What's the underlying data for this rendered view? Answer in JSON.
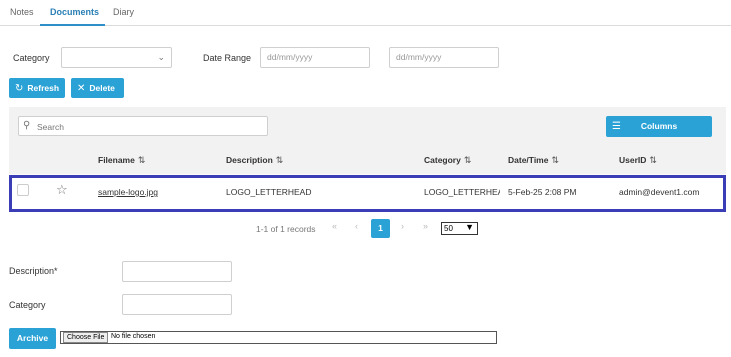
{
  "tabs": [
    {
      "label": "Notes"
    },
    {
      "label": "Documents",
      "active": true
    },
    {
      "label": "Diary"
    }
  ],
  "filters": {
    "category_label": "Category",
    "category_value": "",
    "date_range_label": "Date Range",
    "date_from_placeholder": "dd/mm/yyyy",
    "date_to_placeholder": "dd/mm/yyyy"
  },
  "toolbar": {
    "refresh_label": "Refresh",
    "delete_label": "Delete"
  },
  "table": {
    "search_placeholder": "Search",
    "columns_button_label": "Columns",
    "headers": {
      "filename": "Filename",
      "description": "Description",
      "category": "Category",
      "datetime": "Date/Time",
      "userid": "UserID"
    },
    "rows": [
      {
        "filename": "sample-logo.jpg",
        "description": "LOGO_LETTERHEAD",
        "category": "LOGO_LETTERHEAD",
        "datetime": "5-Feb-25 2:08 PM",
        "userid": "admin@devent1.com"
      }
    ]
  },
  "pagination": {
    "summary": "1-1 of 1 records",
    "current_page": "1",
    "page_size": "50"
  },
  "form": {
    "description_label": "Description*",
    "description_value": "",
    "category_label": "Category",
    "category_value": "",
    "archive_label": "Archive",
    "choose_file_label": "Choose File",
    "file_status": "No file chosen"
  },
  "colors": {
    "accent": "#2aa2d6",
    "tab_active": "#2b7fb5",
    "row_highlight_border": "#3a3db5"
  },
  "icons": {
    "refresh": "refresh-icon",
    "delete": "close-icon",
    "search": "search-icon",
    "columns": "list-icon",
    "sort": "sort-icon",
    "star": "star-icon",
    "chevron": "chevron-down-icon"
  }
}
